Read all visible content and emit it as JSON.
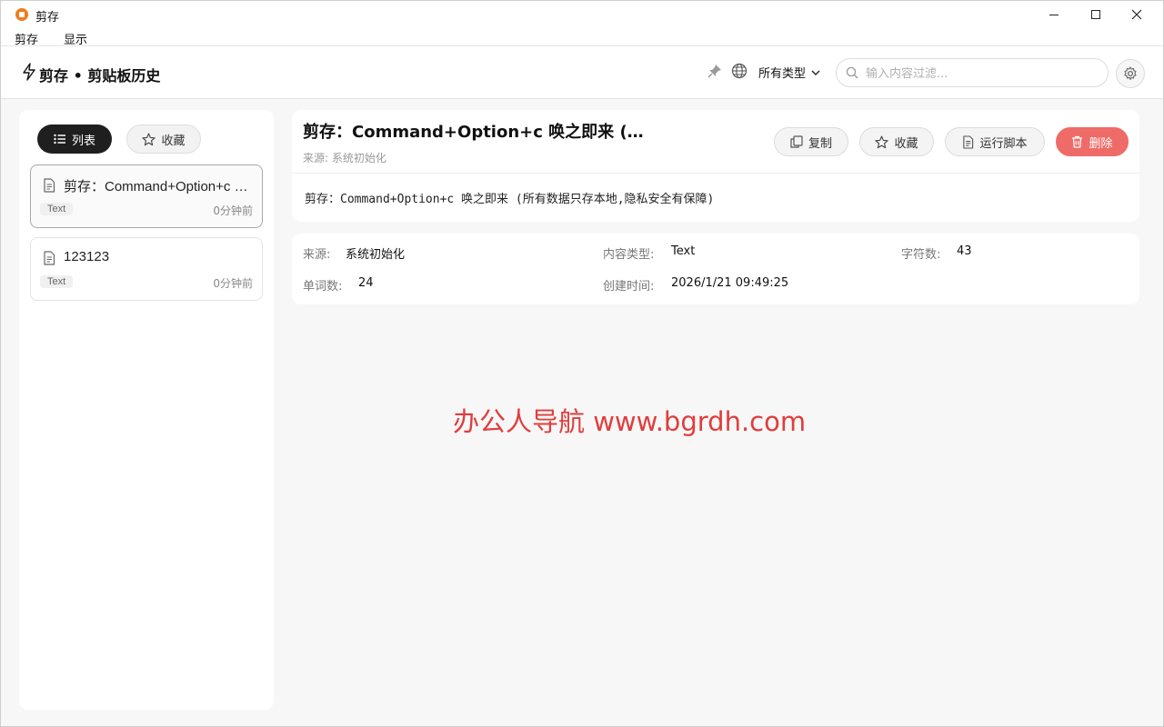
{
  "window": {
    "title": "剪存"
  },
  "menu": {
    "items": [
      "剪存",
      "显示"
    ]
  },
  "header": {
    "title": "剪存 • 剪贴板历史",
    "type_filter": "所有类型",
    "search_placeholder": "输入内容过滤..."
  },
  "sidebar": {
    "tabs": {
      "list": "列表",
      "favorites": "收藏"
    },
    "items": [
      {
        "text": "剪存：Command+Option+c 唤之即来 (所有数据只存本地,隐私安全有保障)",
        "type": "Text",
        "time": "0分钟前",
        "selected": true
      },
      {
        "text": "123123",
        "type": "Text",
        "time": "0分钟前",
        "selected": false
      }
    ]
  },
  "detail": {
    "title": "剪存：Command+Option+c 唤之即来 (所有数据只存本地,隐私安全有保障)",
    "source_line": "来源: 系统初始化",
    "buttons": {
      "copy": "复制",
      "favorite": "收藏",
      "run_script": "运行脚本",
      "delete": "删除"
    },
    "content": "剪存：Command+Option+c 唤之即来 (所有数据只存本地,隐私安全有保障)"
  },
  "info": {
    "source_label": "来源:",
    "source_value": "系统初始化",
    "type_label": "内容类型:",
    "type_value": "Text",
    "chars_label": "字符数:",
    "chars_value": "43",
    "words_label": "单词数:",
    "words_value": "24",
    "created_label": "创建时间:",
    "created_value": "2026/1/21 09:49:25"
  },
  "watermark": "办公人导航  www.bgrdh.com",
  "colors": {
    "delete": "#ef6b67",
    "active_tab": "#1f1f1f",
    "watermark": "#e23c3c",
    "app_icon": "#f07b1b"
  }
}
